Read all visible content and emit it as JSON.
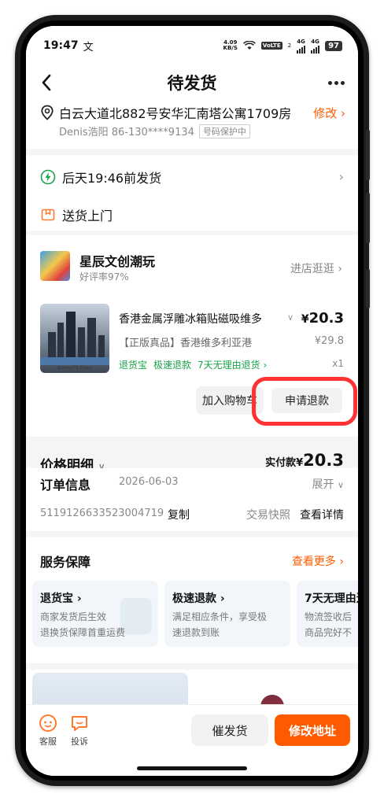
{
  "status_bar": {
    "time": "19:47",
    "time_symbol": "文",
    "net_speed_top": "4.09",
    "net_speed_unit": "KB/S",
    "volte": "VoLTE",
    "sim2": "2",
    "net_type_1": "4G",
    "net_type_2": "4G",
    "battery": "97"
  },
  "nav": {
    "title": "待发货"
  },
  "address": {
    "line": "白云大道北882号安华汇南塔公寓1709房",
    "edit_label": "修改 ›",
    "contact": "Denis浩阳 86-130****9134",
    "protect_badge": "号码保护中"
  },
  "delivery": {
    "ship_time": "后天19:46前发货",
    "method": "送货上门"
  },
  "shop": {
    "name": "星辰文创潮玩",
    "rating": "好评率97%",
    "enter_label": "进店逛逛 ›"
  },
  "product": {
    "title": "香港金属浮雕冰箱贴磁吸维多",
    "price_symbol": "¥",
    "price": "20.3",
    "subtitle": "【正版真品】香港维多利亚港",
    "original_price": "¥29.8",
    "tags": [
      "退货宝",
      "极速退款",
      "7天无理由退货 ›"
    ],
    "quantity": "x1",
    "image_caption": "80mm×79.73mm"
  },
  "actions": {
    "add_to_cart": "加入购物车",
    "request_refund": "申请退款"
  },
  "price_detail": {
    "label": "价格明细",
    "actual_label": "实付款¥",
    "actual_value": "20.3"
  },
  "order": {
    "title": "订单信息",
    "date": "2026-06-03",
    "expand_label": "展开",
    "number": "5119126633523004719",
    "copy_label": "复制",
    "snapshot_label": "交易快照",
    "detail_label": "查看详情"
  },
  "service": {
    "title": "服务保障",
    "more_label": "查看更多 ›",
    "cards": [
      {
        "title": "退货宝 ›",
        "desc1": "商家发货后生效",
        "desc2": "退换货保障首重运费"
      },
      {
        "title": "极速退款 ›",
        "desc1": "满足相应条件，享受极",
        "desc2": "速退款到账"
      },
      {
        "title": "7天无理由退",
        "desc1": "物流签收后",
        "desc2": "商品完好不"
      }
    ]
  },
  "bottom_bar": {
    "service_label": "客服",
    "complaint_label": "投诉",
    "urge_label": "催发货",
    "modify_label": "修改地址"
  },
  "colors": {
    "accent": "#ff5a00",
    "highlight_ring": "#ff3333",
    "green_tag": "#1aa34a"
  }
}
